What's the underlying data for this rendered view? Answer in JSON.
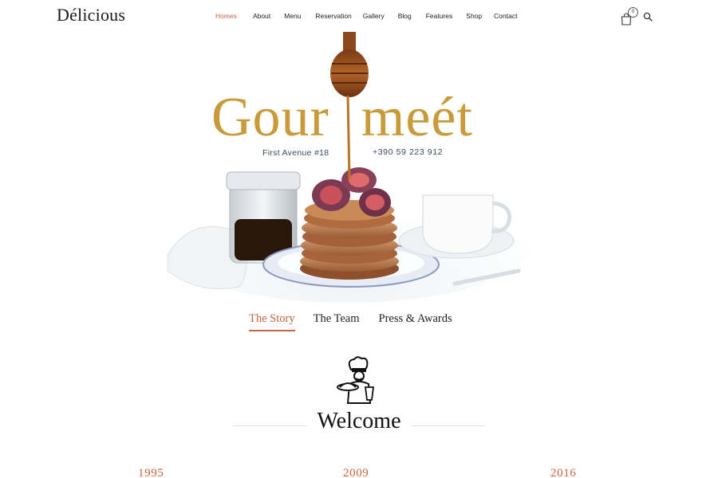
{
  "header": {
    "logo": "Délicious",
    "nav": [
      {
        "label": "Homes",
        "active": true
      },
      {
        "label": "About",
        "active": false
      },
      {
        "label": "Menu",
        "active": false
      },
      {
        "label": "Reservation",
        "active": false
      },
      {
        "label": "Gallery",
        "active": false
      },
      {
        "label": "Blog",
        "active": false
      },
      {
        "label": "Features",
        "active": false
      },
      {
        "label": "Shop",
        "active": false
      },
      {
        "label": "Contact",
        "active": false
      }
    ],
    "cart_icon": "shopping-bag-icon",
    "cart_count": "0",
    "search_icon": "search-icon"
  },
  "hero": {
    "title_left": "Gour",
    "title_right": "meét",
    "address": "First Avenue #18",
    "phone": "+390 59 223 912",
    "image": "pancakes-with-figs-honey-dipper-photo"
  },
  "tabs": [
    {
      "label": "The Story",
      "active": true
    },
    {
      "label": "The Team",
      "active": false
    },
    {
      "label": "Press & Awards",
      "active": false
    }
  ],
  "welcome": {
    "icon": "chef-waiter-icon",
    "heading": "Welcome"
  },
  "years": [
    "1995",
    "2009",
    "2016"
  ],
  "colors": {
    "accent": "#c7643f",
    "title_gold": "#c99a3a",
    "text_dark": "#1b1b1b"
  }
}
